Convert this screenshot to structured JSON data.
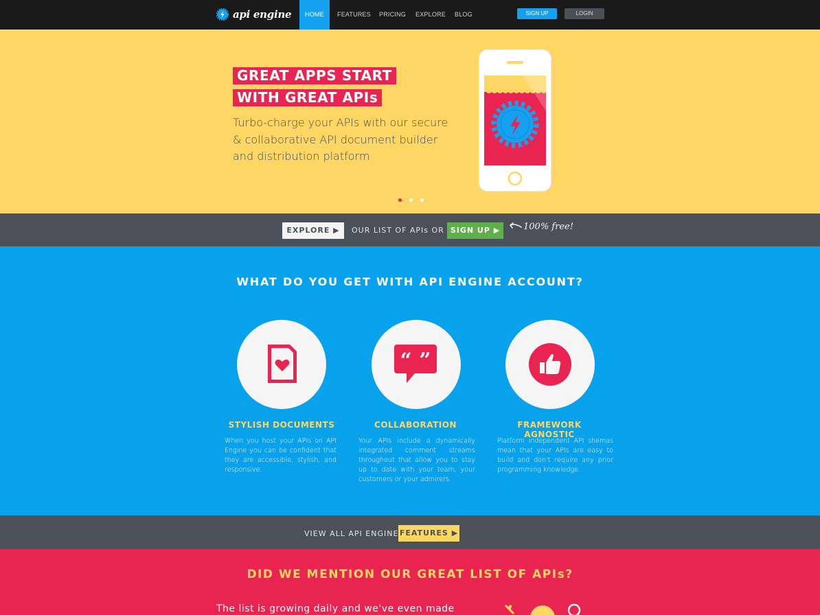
{
  "nav": {
    "logo_text": "api engine",
    "items": [
      {
        "label": "HOME",
        "active": true
      },
      {
        "label": "FEATURES"
      },
      {
        "label": "PRICING"
      },
      {
        "label": "EXPLORE"
      },
      {
        "label": "BLOG"
      }
    ],
    "signup_label": "SIGN UP",
    "login_label": "LOGIN"
  },
  "hero": {
    "title_line1": "GREAT APPS START",
    "title_line2": "WITH GREAT APIs",
    "subtitle": "Turbo-charge your APIs with our secure & collaborative API document builder and distribution platform",
    "carousel": {
      "count": 3,
      "active_index": 0
    }
  },
  "cta_bar": {
    "explore_label": "EXPLORE ▶",
    "middle_text": "OUR LIST OF APIs OR",
    "signup_label": "SIGN UP ▶",
    "free_note": "100% free!"
  },
  "features": {
    "title": "WHAT DO YOU GET WITH API ENGINE ACCOUNT?",
    "items": [
      {
        "icon": "document-heart-icon",
        "title": "STYLISH DOCUMENTS",
        "desc": "When you host your APIs on API Engine you can be confident that they are accessible, stylish, and responsive."
      },
      {
        "icon": "quote-bubble-icon",
        "title": "COLLABORATION",
        "desc": "Your APIs include a dynamically integrated comment streams throughout that allow you to stay up to date with your team, your customers or your admirers."
      },
      {
        "icon": "thumbs-up-icon",
        "title": "FRAMEWORK AGNOSTIC",
        "desc": "Platform independent API shemas mean that your APIs are easy to build and don't require any prior programming knowledge."
      }
    ]
  },
  "features_bar": {
    "text": "VIEW ALL API ENGINE",
    "button_label": "FEATURES ▶"
  },
  "api_list": {
    "title": "DID WE MENTION OUR GREAT LIST OF APIs?",
    "body": "The list is growing daily and we've even made"
  },
  "colors": {
    "yellow": "#fdd664",
    "pink": "#ea2450",
    "blue": "#08a1ec",
    "gray": "#4b5158",
    "green": "#5fb04c"
  }
}
